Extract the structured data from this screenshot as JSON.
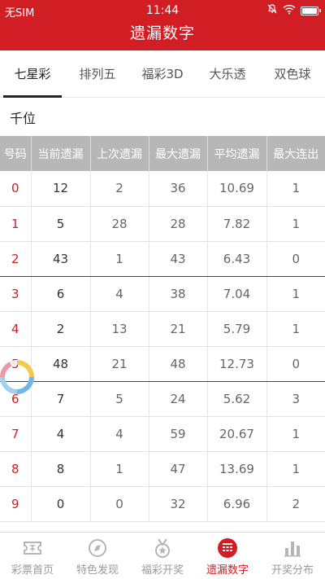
{
  "status_bar": {
    "carrier": "无SIM",
    "time": "11:44"
  },
  "title": "遗漏数字",
  "tabs": [
    {
      "label": "七星彩",
      "active": true
    },
    {
      "label": "排列五",
      "active": false
    },
    {
      "label": "福彩3D",
      "active": false
    },
    {
      "label": "大乐透",
      "active": false
    },
    {
      "label": "双色球",
      "active": false
    }
  ],
  "section_title": "千位",
  "table": {
    "headers": [
      "号码",
      "当前遗漏",
      "上次遗漏",
      "最大遗漏",
      "平均遗漏",
      "最大连出"
    ],
    "rows": [
      [
        "0",
        "12",
        "2",
        "36",
        "10.69",
        "1"
      ],
      [
        "1",
        "5",
        "28",
        "28",
        "7.82",
        "1"
      ],
      [
        "2",
        "43",
        "1",
        "43",
        "6.43",
        "0"
      ],
      [
        "3",
        "6",
        "4",
        "38",
        "7.04",
        "1"
      ],
      [
        "4",
        "2",
        "13",
        "21",
        "5.79",
        "1"
      ],
      [
        "5",
        "48",
        "21",
        "48",
        "12.73",
        "0"
      ],
      [
        "6",
        "7",
        "5",
        "24",
        "5.62",
        "3"
      ],
      [
        "7",
        "4",
        "4",
        "59",
        "20.67",
        "1"
      ],
      [
        "8",
        "8",
        "1",
        "47",
        "13.69",
        "1"
      ],
      [
        "9",
        "0",
        "0",
        "32",
        "6.96",
        "2"
      ]
    ]
  },
  "bottom_nav": [
    {
      "label": "彩票首页",
      "icon": "lottery-ticket-icon",
      "active": false
    },
    {
      "label": "特色发现",
      "icon": "compass-icon",
      "active": false
    },
    {
      "label": "福彩开奖",
      "icon": "medal-icon",
      "active": false
    },
    {
      "label": "遗漏数字",
      "icon": "grid-list-icon",
      "active": true
    },
    {
      "label": "开奖分布",
      "icon": "bar-chart-icon",
      "active": false
    }
  ],
  "colors": {
    "accent": "#d11d24",
    "header_bg": "#b7b7b7",
    "inactive": "#9a9a9a"
  }
}
